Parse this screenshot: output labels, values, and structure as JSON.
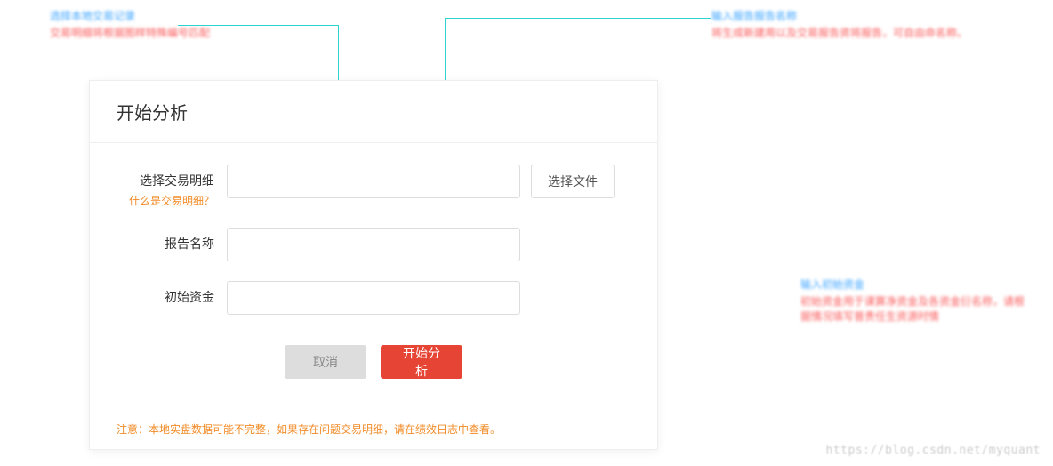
{
  "callouts": {
    "top_left": {
      "title": "选择本地交易记录",
      "desc": "交易明细将根据图样特殊编号匹配"
    },
    "top_right": {
      "title": "输入报告报告名称",
      "desc": "将生成新建用以及交易报告资将报告，可自由命名称。"
    },
    "right_mid": {
      "title": "输入初始资金",
      "desc": "初始资金用于课算净资金及各资金衍名称，请根据情况填写普责任生资源时情"
    }
  },
  "modal": {
    "title": "开始分析",
    "fields": {
      "file": {
        "label": "选择交易明细",
        "help": "什么是交易明细？",
        "button": "选择文件"
      },
      "name": {
        "label": "报告名称"
      },
      "capital": {
        "label": "初始资金"
      }
    },
    "actions": {
      "cancel": "取消",
      "submit": "开始分析"
    },
    "note": "注意：本地实盘数据可能不完整，如果存在问题交易明细，请在绩效日志中查看。"
  },
  "watermark": "https://blog.csdn.net/myquant"
}
